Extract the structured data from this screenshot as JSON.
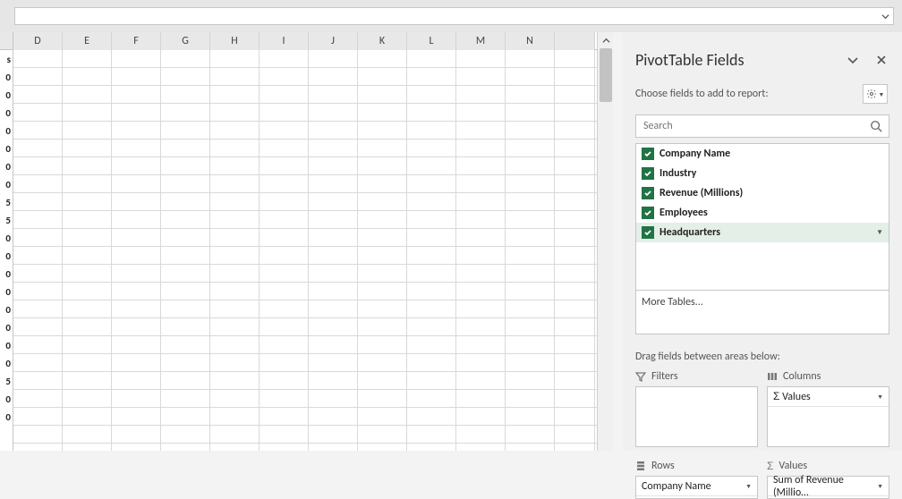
{
  "formula_bar": {
    "value": ""
  },
  "grid": {
    "columns": [
      "D",
      "E",
      "F",
      "G",
      "H",
      "I",
      "J",
      "K",
      "L",
      "M",
      "N"
    ],
    "stub_values": [
      "s",
      "0",
      "0",
      "0",
      "0",
      "0",
      "0",
      "0",
      "5",
      "5",
      "0",
      "0",
      "0",
      "0",
      "0",
      "0",
      "0",
      "0",
      "5",
      "0",
      "0"
    ]
  },
  "pane": {
    "title": "PivotTable Fields",
    "choose_text": "Choose fields to add to report:",
    "search_placeholder": "Search",
    "fields": [
      {
        "label": "Company Name",
        "checked": true
      },
      {
        "label": "Industry",
        "checked": true
      },
      {
        "label": "Revenue (Millions)",
        "checked": true
      },
      {
        "label": "Employees",
        "checked": true
      },
      {
        "label": "Headquarters",
        "checked": true,
        "hover": true
      }
    ],
    "more_tables": "More Tables...",
    "drag_text": "Drag fields between areas below:",
    "areas": {
      "filters_label": "Filters",
      "columns_label": "Columns",
      "rows_label": "Rows",
      "values_label": "Values",
      "columns_items": [
        {
          "label": "Values",
          "sigma": true
        }
      ],
      "rows_items": [
        {
          "label": "Company Name"
        }
      ],
      "values_items": [
        {
          "label": "Sum of Revenue (Millio…"
        }
      ]
    }
  }
}
